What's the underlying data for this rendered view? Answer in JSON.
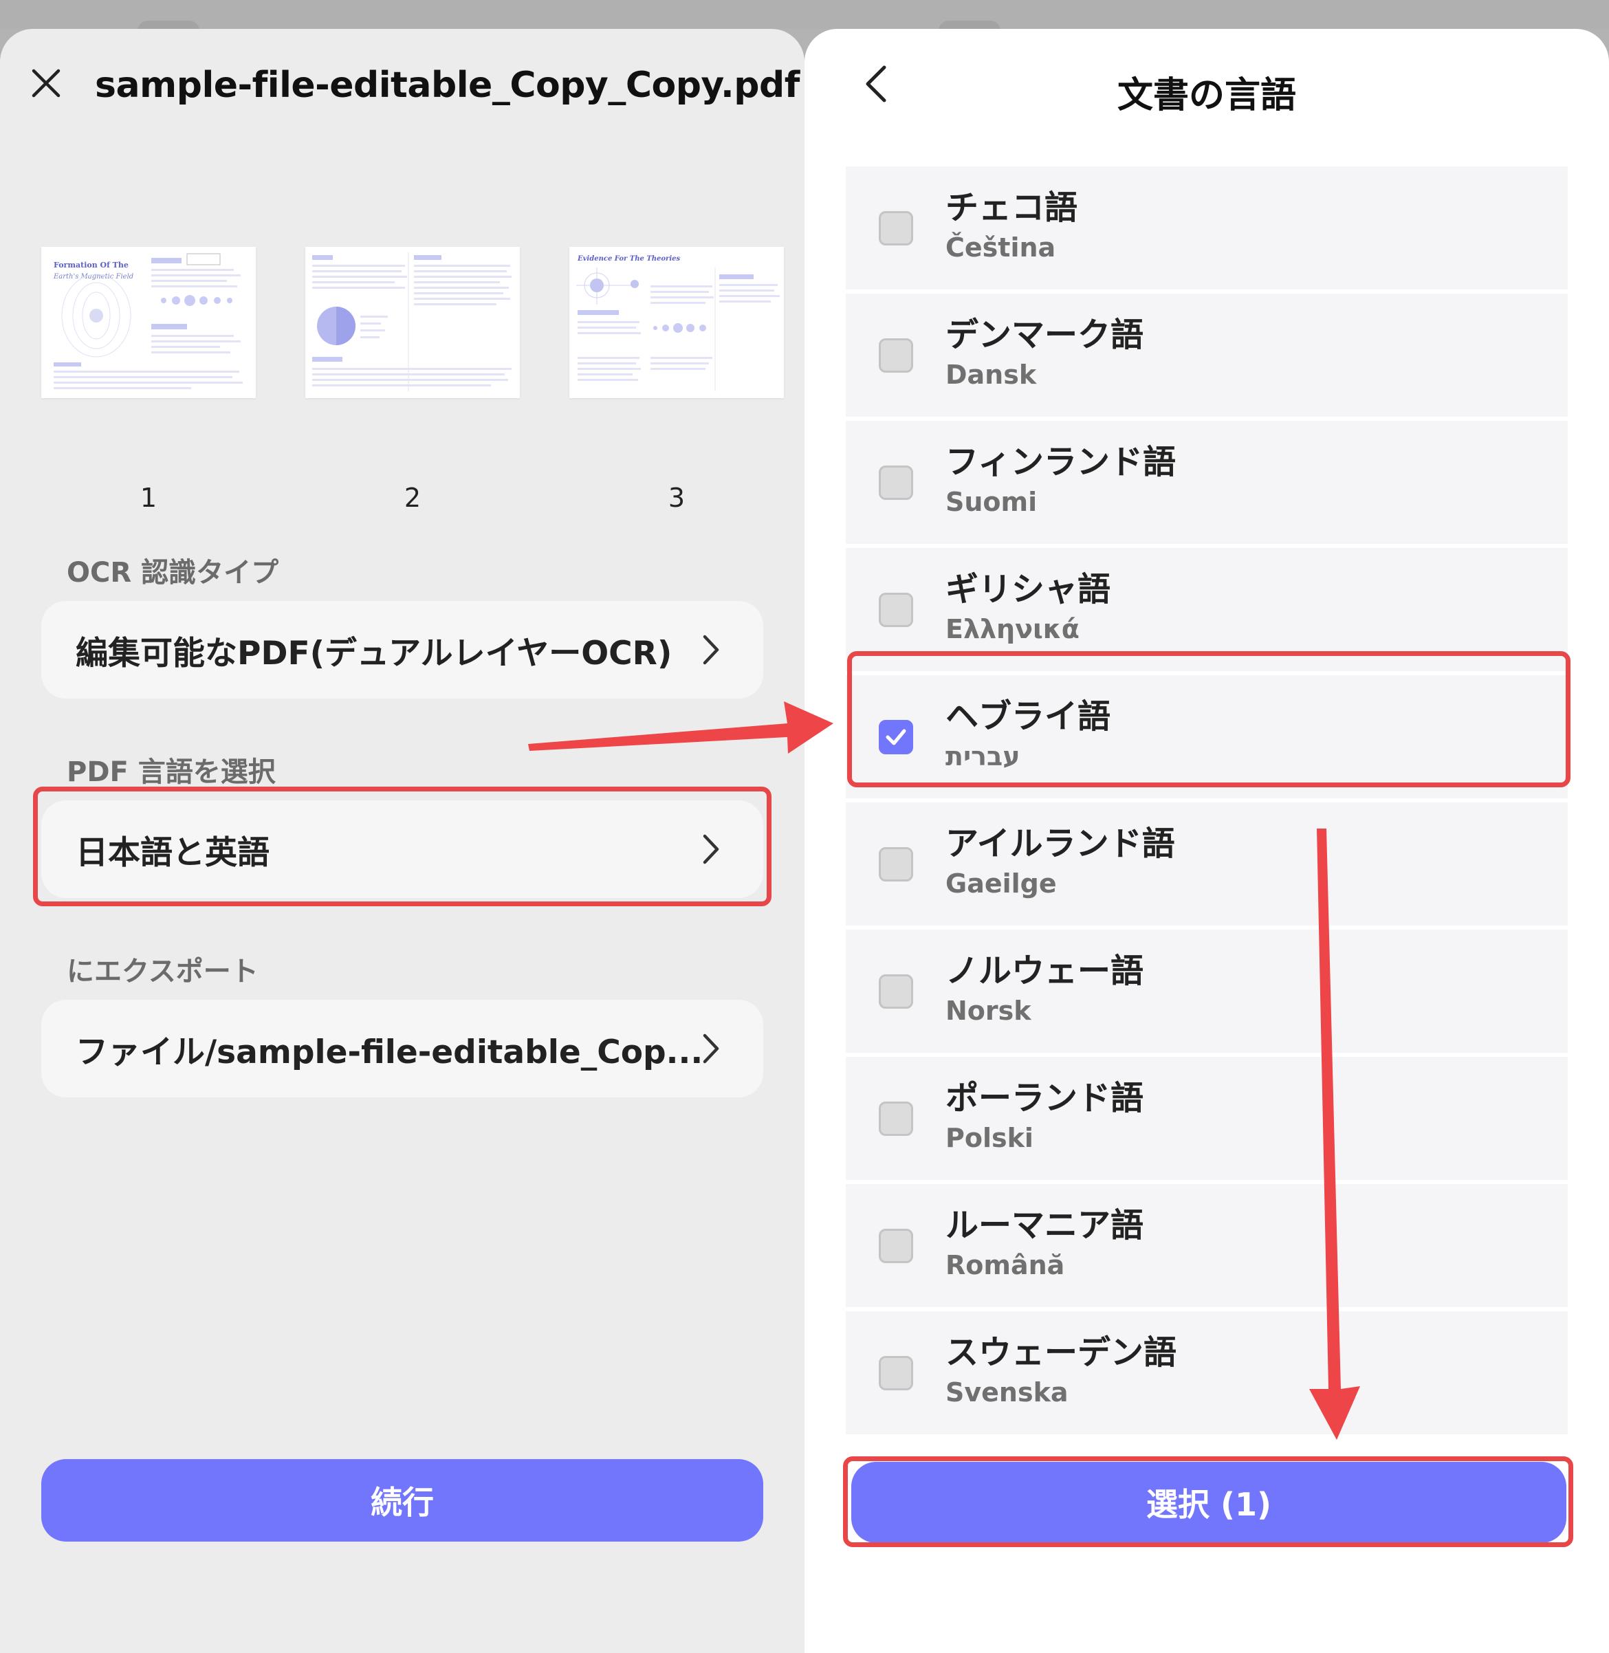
{
  "ocr_screen": {
    "title": "sample-file-editable_Copy_Copy.pdf",
    "thumbnails": [
      {
        "page": "1",
        "heading": "Formation Of The",
        "subheading": "Earth's Magnetic Field"
      },
      {
        "page": "2",
        "heading": "",
        "subheading": ""
      },
      {
        "page": "3",
        "heading": "Evidence For The Theories",
        "subheading": ""
      }
    ],
    "ocr_type_label": "OCR 認識タイプ",
    "ocr_type_value": "編集可能なPDF(デュアルレイヤーOCR)",
    "language_label": "PDF 言語を選択",
    "language_value": "日本語と英語",
    "export_label": "にエクスポート",
    "export_value": "ファイル/sample-file-editable_Cop...",
    "continue_label": "続行"
  },
  "language_screen": {
    "title": "文書の言語",
    "languages": [
      {
        "name": "チェコ語",
        "native": "Čeština",
        "checked": false
      },
      {
        "name": "デンマーク語",
        "native": "Dansk",
        "checked": false
      },
      {
        "name": "フィンランド語",
        "native": "Suomi",
        "checked": false
      },
      {
        "name": "ギリシャ語",
        "native": "Ελληνικά",
        "checked": false
      },
      {
        "name": "ヘブライ語",
        "native": "עברית",
        "checked": true
      },
      {
        "name": "アイルランド語",
        "native": "Gaeilge",
        "checked": false
      },
      {
        "name": "ノルウェー語",
        "native": "Norsk",
        "checked": false
      },
      {
        "name": "ポーランド語",
        "native": "Polski",
        "checked": false
      },
      {
        "name": "ルーマニア語",
        "native": "Română",
        "checked": false
      },
      {
        "name": "スウェーデン語",
        "native": "Svenska",
        "checked": false
      }
    ],
    "select_label": "選択 (1)"
  },
  "colors": {
    "accent": "#7276fc",
    "annotation_red": "#e8474a",
    "sheet_left": "#ececec",
    "sheet_right": "#ffffff"
  }
}
